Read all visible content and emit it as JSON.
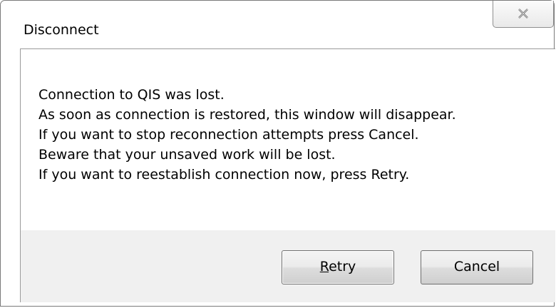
{
  "window": {
    "title": "Disconnect",
    "close_icon": "close-x-icon"
  },
  "message": {
    "lines": [
      "Connection to QIS was lost.",
      "As soon as connection is restored, this window will disappear.",
      "If you want to stop reconnection attempts press Cancel.",
      "Beware that your unsaved work will be lost.",
      "If you want to reestablish connection now, press Retry."
    ]
  },
  "buttons": {
    "retry": {
      "accelerator": "R",
      "rest": "etry"
    },
    "cancel_label": "Cancel"
  },
  "colors": {
    "button_area": "#f0f0f0",
    "border": "#7a7a7a"
  }
}
